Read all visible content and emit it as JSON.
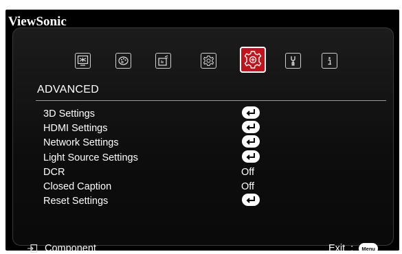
{
  "brand": "ViewSonic",
  "tabs": [
    {
      "id": "display",
      "icon": "display-icon"
    },
    {
      "id": "image",
      "icon": "palette-icon"
    },
    {
      "id": "power",
      "icon": "power-management-icon"
    },
    {
      "id": "basic",
      "icon": "gear-icon"
    },
    {
      "id": "advanced",
      "icon": "advanced-gear-icon",
      "active": true
    },
    {
      "id": "system",
      "icon": "wrench-icon"
    },
    {
      "id": "information",
      "icon": "info-icon"
    }
  ],
  "section_title": "ADVANCED",
  "items": [
    {
      "label": "3D Settings",
      "type": "enter",
      "icon": "enter-icon"
    },
    {
      "label": "HDMI Settings",
      "type": "enter",
      "icon": "enter-icon"
    },
    {
      "label": "Network Settings",
      "type": "enter",
      "icon": "enter-icon"
    },
    {
      "label": "Light Source Settings",
      "type": "enter",
      "icon": "enter-icon"
    },
    {
      "label": "DCR",
      "type": "value",
      "value": "Off"
    },
    {
      "label": "Closed Caption",
      "type": "value",
      "value": "Off"
    },
    {
      "label": "Reset Settings",
      "type": "enter",
      "icon": "enter-icon"
    }
  ],
  "footer": {
    "source_label": "Component",
    "source_icon": "input-source-icon",
    "exit_label": "Exit",
    "separator": ":",
    "menu_button_label": "Menu"
  },
  "colors": {
    "background": "#000000",
    "active_tab": "#c0141c",
    "text": "#ffffff"
  }
}
